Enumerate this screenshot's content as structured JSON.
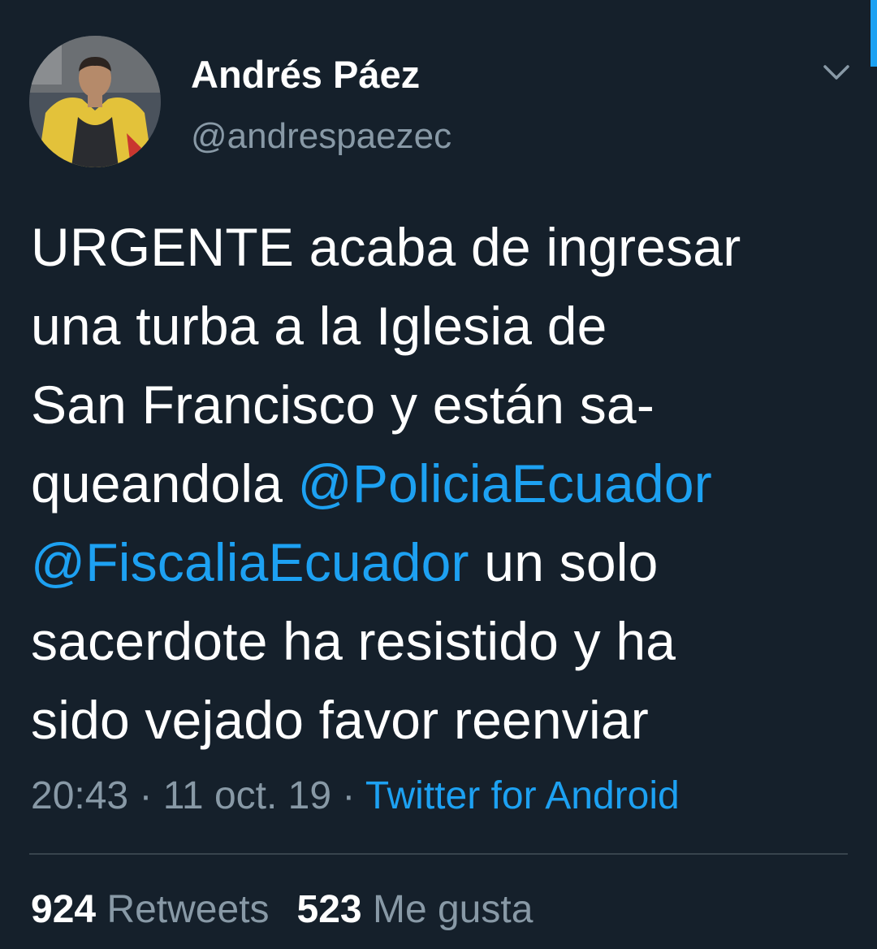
{
  "colors": {
    "background": "#15202b",
    "text": "#ffffff",
    "secondary_text": "#8899a6",
    "link": "#1da1f2",
    "divider": "#38444d"
  },
  "tweet": {
    "author": {
      "name": "Andrés Páez",
      "handle": "@andrespaezec",
      "avatar_icon": "user-avatar"
    },
    "menu_icon": "chevron-down-icon",
    "text": {
      "line1": "URGENTE acaba de ingresar",
      "line2": "una turba a la Iglesia de",
      "line3": "San Francisco y están sa-",
      "line4_text": "queandola ",
      "mention1": "@PoliciaEcuador",
      "mention2": "@FiscaliaEcuador",
      "line5_text": " un solo",
      "line6": "sacerdote ha resistido y ha",
      "line7": "sido vejado favor reenviar"
    },
    "time": "20:43",
    "separator": " · ",
    "date": "11 oct. 19",
    "source": "Twitter for Android",
    "stats": {
      "retweets_count": "924",
      "retweets_label": "Retweets",
      "likes_count": "523",
      "likes_label": "Me gusta"
    }
  }
}
